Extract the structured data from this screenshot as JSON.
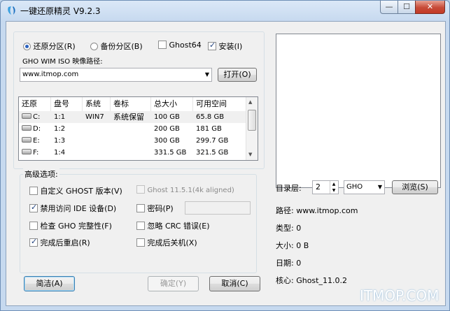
{
  "window": {
    "title": "一键还原精灵 V9.2.3",
    "close_glyph": "✕",
    "min_glyph": "—",
    "max_glyph": "☐"
  },
  "options": {
    "restore": "还原分区(R)",
    "backup": "备份分区(B)",
    "ghost64": "Ghost64",
    "install": "安装(I)"
  },
  "path": {
    "label": "GHO WIM ISO 映像路径:",
    "value": "www.itmop.com",
    "open_button": "打开(O)"
  },
  "partitions": {
    "headers": [
      "还原",
      "盘号",
      "系统",
      "卷标",
      "总大小",
      "可用空间"
    ],
    "rows": [
      {
        "drive": "C:",
        "num": "1:1",
        "system": "WIN7",
        "label": "系统保留",
        "total": "100 GB",
        "free": "65.8 GB"
      },
      {
        "drive": "D:",
        "num": "1:2",
        "system": "",
        "label": "",
        "total": "200 GB",
        "free": "181 GB"
      },
      {
        "drive": "E:",
        "num": "1:3",
        "system": "",
        "label": "",
        "total": "300 GB",
        "free": "299.7 GB"
      },
      {
        "drive": "F:",
        "num": "1:4",
        "system": "",
        "label": "",
        "total": "331.5 GB",
        "free": "321.5 GB"
      }
    ]
  },
  "advanced": {
    "title": "高级选项:",
    "custom_ghost": "自定义 GHOST 版本(V)",
    "ghost_version": "Ghost 11.5.1(4k aligned)",
    "disable_ide": "禁用访问 IDE 设备(D)",
    "password": "密码(P)",
    "check_gho": "检查 GHO 完整性(F)",
    "ignore_crc": "忽略 CRC 错误(E)",
    "restart": "完成后重启(R)",
    "shutdown": "完成后关机(X)"
  },
  "buttons": {
    "simple": "简洁(A)",
    "ok": "确定(Y)",
    "cancel": "取消(C)"
  },
  "info": {
    "dir_level_label": "目录层:",
    "dir_level_value": "2",
    "type_combo": "GHO",
    "browse": "浏览(S)",
    "path": "路径: www.itmop.com",
    "type": "类型: 0",
    "size": "大小: 0 B",
    "date": "日期: 0",
    "core": "核心: Ghost_11.0.2"
  },
  "watermark": "ITMOP.COM",
  "colors": {
    "accent": "#2b62c0",
    "title_bar": "#c6d9ef"
  }
}
